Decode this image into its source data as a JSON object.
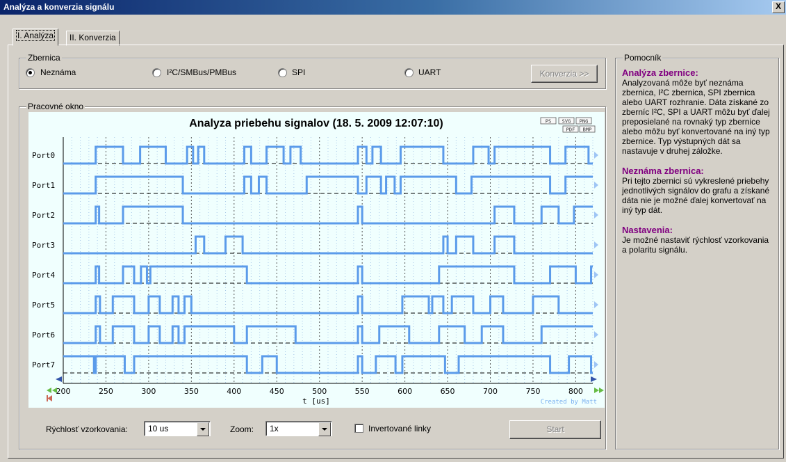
{
  "window": {
    "title": "Analýza a konverzia signálu",
    "close_label": "X"
  },
  "tabs": [
    {
      "label": "I. Analýza",
      "active": true
    },
    {
      "label": "II. Konverzia",
      "active": false
    }
  ],
  "bus": {
    "legend": "Zbernica",
    "options": [
      {
        "label": "Neznáma",
        "selected": true
      },
      {
        "label": "I²C/SMBus/PMBus",
        "selected": false
      },
      {
        "label": "SPI",
        "selected": false
      },
      {
        "label": "UART",
        "selected": false
      }
    ],
    "convert_button": "Konverzia >>"
  },
  "workspace": {
    "legend": "Pracovné okno"
  },
  "chart_data": {
    "type": "line",
    "title": "Analyza priebehu signalov (18. 5. 2009 12:07:10)",
    "xlabel": "t [us]",
    "xlim": [
      200,
      820
    ],
    "x_ticks": [
      200,
      250,
      300,
      350,
      400,
      450,
      500,
      550,
      600,
      650,
      700,
      750,
      800
    ],
    "credit": "Created by Matt",
    "export_buttons": [
      "PS",
      "SVG",
      "PNG",
      "PDF",
      "BMP"
    ],
    "line_color": "#5b9bea",
    "series": [
      {
        "name": "Port0",
        "transitions": [
          [
            200,
            0
          ],
          [
            238,
            1
          ],
          [
            270,
            0
          ],
          [
            290,
            1
          ],
          [
            320,
            0
          ],
          [
            345,
            1
          ],
          [
            352,
            0
          ],
          [
            358,
            1
          ],
          [
            365,
            0
          ],
          [
            412,
            1
          ],
          [
            420,
            0
          ],
          [
            438,
            1
          ],
          [
            458,
            0
          ],
          [
            466,
            1
          ],
          [
            478,
            0
          ],
          [
            545,
            1
          ],
          [
            555,
            0
          ],
          [
            562,
            1
          ],
          [
            572,
            0
          ],
          [
            595,
            1
          ],
          [
            645,
            0
          ],
          [
            680,
            1
          ],
          [
            698,
            0
          ],
          [
            705,
            1
          ],
          [
            770,
            0
          ],
          [
            788,
            1
          ],
          [
            815,
            0
          ],
          [
            820,
            0
          ]
        ]
      },
      {
        "name": "Port1",
        "transitions": [
          [
            200,
            0
          ],
          [
            238,
            1
          ],
          [
            340,
            0
          ],
          [
            412,
            1
          ],
          [
            420,
            0
          ],
          [
            429,
            1
          ],
          [
            438,
            0
          ],
          [
            485,
            1
          ],
          [
            545,
            0
          ],
          [
            555,
            1
          ],
          [
            572,
            0
          ],
          [
            578,
            1
          ],
          [
            588,
            0
          ],
          [
            595,
            1
          ],
          [
            660,
            0
          ],
          [
            678,
            1
          ],
          [
            770,
            0
          ],
          [
            788,
            1
          ],
          [
            820,
            1
          ]
        ]
      },
      {
        "name": "Port2",
        "transitions": [
          [
            200,
            0
          ],
          [
            238,
            1
          ],
          [
            242,
            0
          ],
          [
            270,
            1
          ],
          [
            340,
            0
          ],
          [
            545,
            1
          ],
          [
            550,
            0
          ],
          [
            705,
            1
          ],
          [
            728,
            0
          ],
          [
            760,
            1
          ],
          [
            780,
            0
          ],
          [
            798,
            1
          ],
          [
            820,
            1
          ]
        ]
      },
      {
        "name": "Port3",
        "transitions": [
          [
            200,
            0
          ],
          [
            355,
            1
          ],
          [
            365,
            0
          ],
          [
            390,
            1
          ],
          [
            410,
            0
          ],
          [
            645,
            1
          ],
          [
            650,
            0
          ],
          [
            660,
            1
          ],
          [
            680,
            0
          ],
          [
            705,
            1
          ],
          [
            728,
            0
          ],
          [
            820,
            0
          ]
        ]
      },
      {
        "name": "Port4",
        "transitions": [
          [
            200,
            0
          ],
          [
            238,
            1
          ],
          [
            242,
            0
          ],
          [
            270,
            1
          ],
          [
            283,
            0
          ],
          [
            291,
            1
          ],
          [
            298,
            0
          ],
          [
            302,
            1
          ],
          [
            415,
            0
          ],
          [
            545,
            1
          ],
          [
            550,
            0
          ],
          [
            640,
            1
          ],
          [
            728,
            0
          ],
          [
            770,
            1
          ],
          [
            800,
            0
          ],
          [
            818,
            1
          ],
          [
            820,
            1
          ]
        ]
      },
      {
        "name": "Port5",
        "transitions": [
          [
            200,
            0
          ],
          [
            238,
            1
          ],
          [
            243,
            0
          ],
          [
            258,
            1
          ],
          [
            283,
            0
          ],
          [
            300,
            1
          ],
          [
            313,
            0
          ],
          [
            328,
            1
          ],
          [
            335,
            0
          ],
          [
            342,
            1
          ],
          [
            350,
            0
          ],
          [
            545,
            1
          ],
          [
            550,
            0
          ],
          [
            597,
            1
          ],
          [
            628,
            0
          ],
          [
            632,
            1
          ],
          [
            645,
            0
          ],
          [
            655,
            1
          ],
          [
            680,
            0
          ],
          [
            700,
            1
          ],
          [
            715,
            0
          ],
          [
            750,
            1
          ],
          [
            780,
            0
          ],
          [
            820,
            0
          ]
        ]
      },
      {
        "name": "Port6",
        "transitions": [
          [
            200,
            0
          ],
          [
            238,
            1
          ],
          [
            243,
            0
          ],
          [
            258,
            1
          ],
          [
            283,
            0
          ],
          [
            300,
            1
          ],
          [
            313,
            0
          ],
          [
            328,
            1
          ],
          [
            335,
            0
          ],
          [
            342,
            1
          ],
          [
            400,
            0
          ],
          [
            415,
            1
          ],
          [
            472,
            0
          ],
          [
            545,
            1
          ],
          [
            550,
            0
          ],
          [
            570,
            1
          ],
          [
            605,
            0
          ],
          [
            640,
            1
          ],
          [
            670,
            0
          ],
          [
            690,
            1
          ],
          [
            715,
            0
          ],
          [
            760,
            1
          ],
          [
            820,
            1
          ]
        ]
      },
      {
        "name": "Port7",
        "transitions": [
          [
            200,
            1
          ],
          [
            236,
            0
          ],
          [
            238,
            1
          ],
          [
            272,
            0
          ],
          [
            283,
            1
          ],
          [
            415,
            0
          ],
          [
            433,
            1
          ],
          [
            450,
            0
          ],
          [
            545,
            1
          ],
          [
            550,
            0
          ],
          [
            566,
            1
          ],
          [
            589,
            0
          ],
          [
            597,
            1
          ],
          [
            647,
            0
          ],
          [
            663,
            1
          ],
          [
            770,
            0
          ],
          [
            792,
            1
          ],
          [
            818,
            0
          ],
          [
            820,
            0
          ]
        ]
      }
    ]
  },
  "controls": {
    "sampling_label": "Rýchlosť vzorkovania:",
    "sampling_value": "10 us",
    "zoom_label": "Zoom:",
    "zoom_value": "1x",
    "invert_label": "Invertované linky",
    "invert_checked": false,
    "start_button": "Start"
  },
  "helper": {
    "legend": "Pomocník",
    "sections": [
      {
        "title": "Analýza zbernice:",
        "body": "Analyzovaná môže byť neznáma zbernica, I²C zbernica, SPI zbernica alebo UART rozhranie. Dáta získané zo zberníc I²C, SPI a UART môžu byť ďalej preposielané na rovnaký typ zbernice alebo môžu byť konvertované na iný typ zbernice. Typ výstupných dát sa nastavuje v druhej záložke."
      },
      {
        "title": "Neznáma zbernica:",
        "body": "Pri tejto zbernici sú vykreslené priebehy jednotlivých signálov do grafu a získané dáta nie je možné ďalej konvertovať na iný typ dát."
      },
      {
        "title": "Nastavenia:",
        "body": "Je možné nastaviť rýchlosť vzorkovania a polaritu signálu."
      }
    ]
  }
}
